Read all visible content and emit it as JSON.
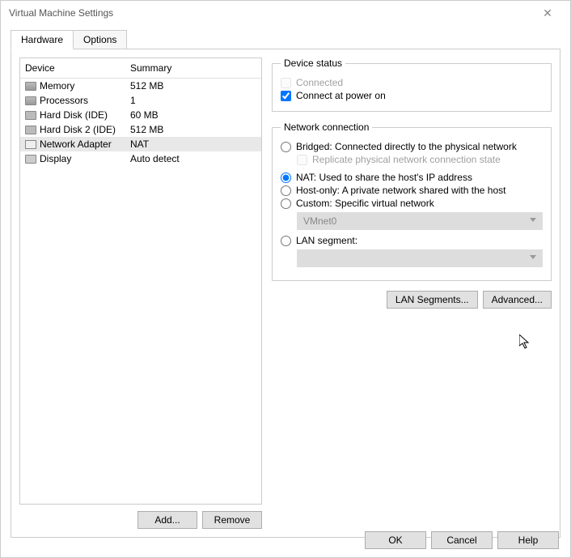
{
  "window": {
    "title": "Virtual Machine Settings"
  },
  "tabs": {
    "hardware": "Hardware",
    "options": "Options"
  },
  "headers": {
    "device": "Device",
    "summary": "Summary"
  },
  "devices": [
    {
      "name": "Memory",
      "summary": "512 MB",
      "icon": "chip"
    },
    {
      "name": "Processors",
      "summary": "1",
      "icon": "chip"
    },
    {
      "name": "Hard Disk (IDE)",
      "summary": "60 MB",
      "icon": "disk"
    },
    {
      "name": "Hard Disk 2 (IDE)",
      "summary": "512 MB",
      "icon": "disk"
    },
    {
      "name": "Network Adapter",
      "summary": "NAT",
      "icon": "net",
      "selected": true
    },
    {
      "name": "Display",
      "summary": "Auto detect",
      "icon": "display"
    }
  ],
  "buttons": {
    "add": "Add...",
    "remove": "Remove",
    "lan_segments": "LAN Segments...",
    "advanced": "Advanced...",
    "ok": "OK",
    "cancel": "Cancel",
    "help": "Help"
  },
  "device_status": {
    "legend": "Device status",
    "connected": "Connected",
    "connect_on_power": "Connect at power on"
  },
  "network_connection": {
    "legend": "Network connection",
    "bridged": "Bridged: Connected directly to the physical network",
    "replicate": "Replicate physical network connection state",
    "nat": "NAT: Used to share the host's IP address",
    "host_only": "Host-only: A private network shared with the host",
    "custom": "Custom: Specific virtual network",
    "custom_value": "VMnet0",
    "lan_segment": "LAN segment:",
    "lan_value": ""
  }
}
